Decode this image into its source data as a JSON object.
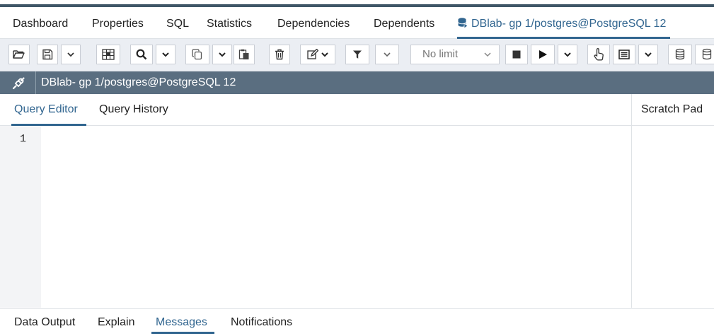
{
  "main_tabs": [
    {
      "label": "Dashboard"
    },
    {
      "label": "Properties"
    },
    {
      "label": "SQL"
    },
    {
      "label": "Statistics"
    },
    {
      "label": "Dependencies"
    },
    {
      "label": "Dependents"
    },
    {
      "label": "DBlab- gp 1/postgres@PostgreSQL 12",
      "icon": "database-icon",
      "active": true
    }
  ],
  "toolbar": {
    "buttons": [
      {
        "icon": "open-folder-icon"
      },
      {
        "icon": "save-icon"
      },
      {
        "icon": "chevron-down-icon"
      },
      {
        "icon": "grid-icon"
      },
      {
        "icon": "search-icon"
      },
      {
        "icon": "chevron-down-icon"
      },
      {
        "icon": "copy-icon"
      },
      {
        "icon": "chevron-down-icon"
      },
      {
        "icon": "paste-icon"
      },
      {
        "icon": "trash-icon"
      },
      {
        "icon": "edit-icon"
      },
      {
        "icon": "filter-icon"
      },
      {
        "icon": "chevron-down-icon"
      },
      {
        "icon": "stop-icon"
      },
      {
        "icon": "play-icon"
      },
      {
        "icon": "chevron-down-icon"
      },
      {
        "icon": "pointer-icon"
      },
      {
        "icon": "list-icon"
      },
      {
        "icon": "chevron-down-icon"
      },
      {
        "icon": "database-commit-icon"
      },
      {
        "icon": "database-rollback-icon"
      }
    ],
    "limit_select": {
      "value": "No limit"
    }
  },
  "connection": {
    "label": "DBlab- gp 1/postgres@PostgreSQL 12",
    "icon": "connection-plug-icon"
  },
  "editor_tabs": [
    {
      "label": "Query Editor",
      "active": true
    },
    {
      "label": "Query History"
    }
  ],
  "scratch_pad": {
    "label": "Scratch Pad"
  },
  "editor": {
    "line_numbers": [
      "1"
    ]
  },
  "bottom_tabs": [
    {
      "label": "Data Output"
    },
    {
      "label": "Explain"
    },
    {
      "label": "Messages",
      "active": true
    },
    {
      "label": "Notifications"
    }
  ],
  "colors": {
    "accent": "#326690",
    "connection_bar": "#5a6e80",
    "toolbar_bg": "#ebeef3",
    "top_bar": "#3f5667"
  }
}
